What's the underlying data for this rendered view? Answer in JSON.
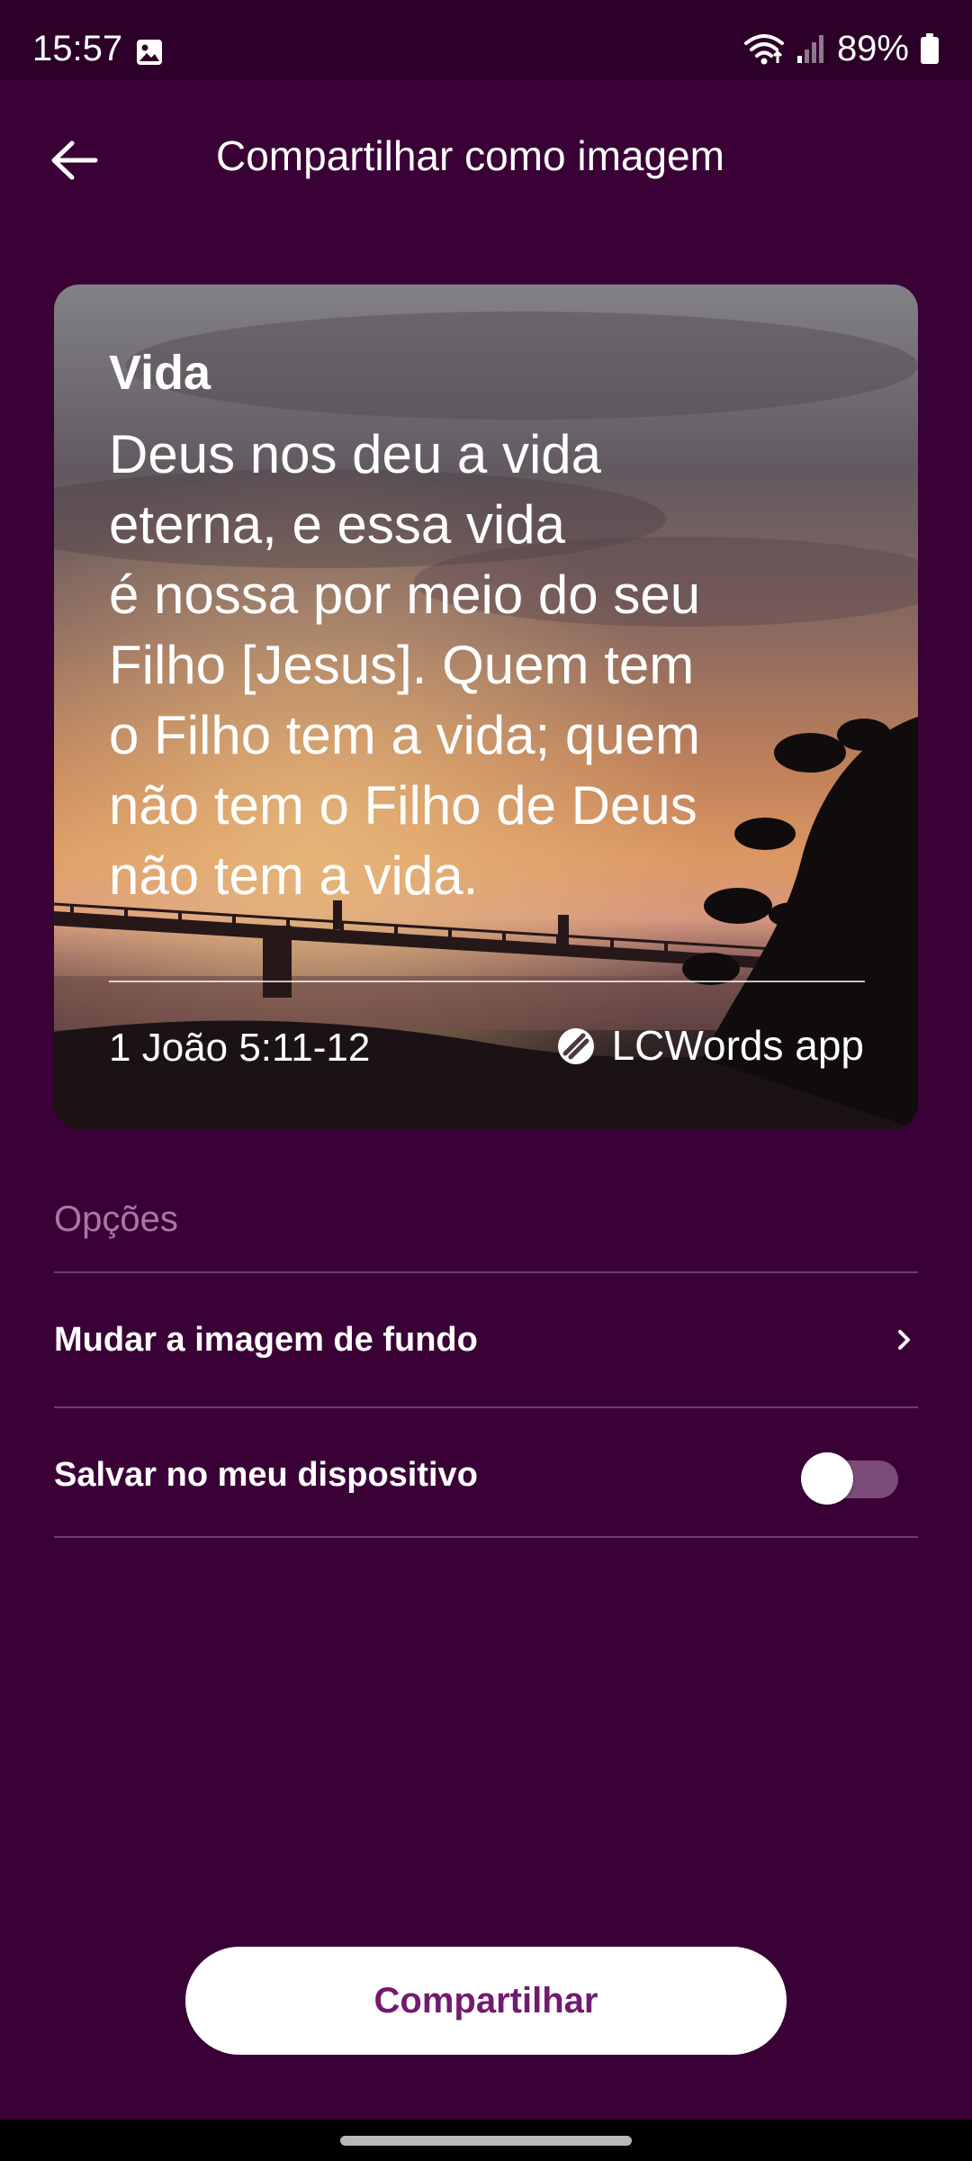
{
  "status_bar": {
    "time": "15:57",
    "battery": "89%",
    "icons": [
      "gallery-icon",
      "wifi-icon",
      "signal-icon",
      "battery-icon"
    ]
  },
  "header": {
    "title": "Compartilhar como imagem",
    "back_icon": "arrow-left-icon"
  },
  "preview": {
    "title": "Vida",
    "text": "Deus nos deu a vida\neterna, e essa vida\né nossa por meio do seu\nFilho [Jesus]. Quem tem\no Filho tem a vida; quem\nnão tem o Filho de Deus\nnão tem a vida.",
    "reference": "1 João 5:11-12",
    "brand": "LCWords app",
    "brand_icon": "lcwords-logo-icon"
  },
  "options": {
    "heading": "Opções",
    "items": [
      {
        "label": "Mudar a imagem de fundo",
        "control": "chevron-right-icon"
      },
      {
        "label": "Salvar no meu dispositivo",
        "control": "toggle",
        "checked": false
      }
    ]
  },
  "share_button": {
    "label": "Compartilhar"
  },
  "colors": {
    "background": "#3a0137",
    "status_bar": "#2c0029",
    "accent_text": "#731a70",
    "muted_text": "#a679a3",
    "divider": "#6b3e68"
  }
}
